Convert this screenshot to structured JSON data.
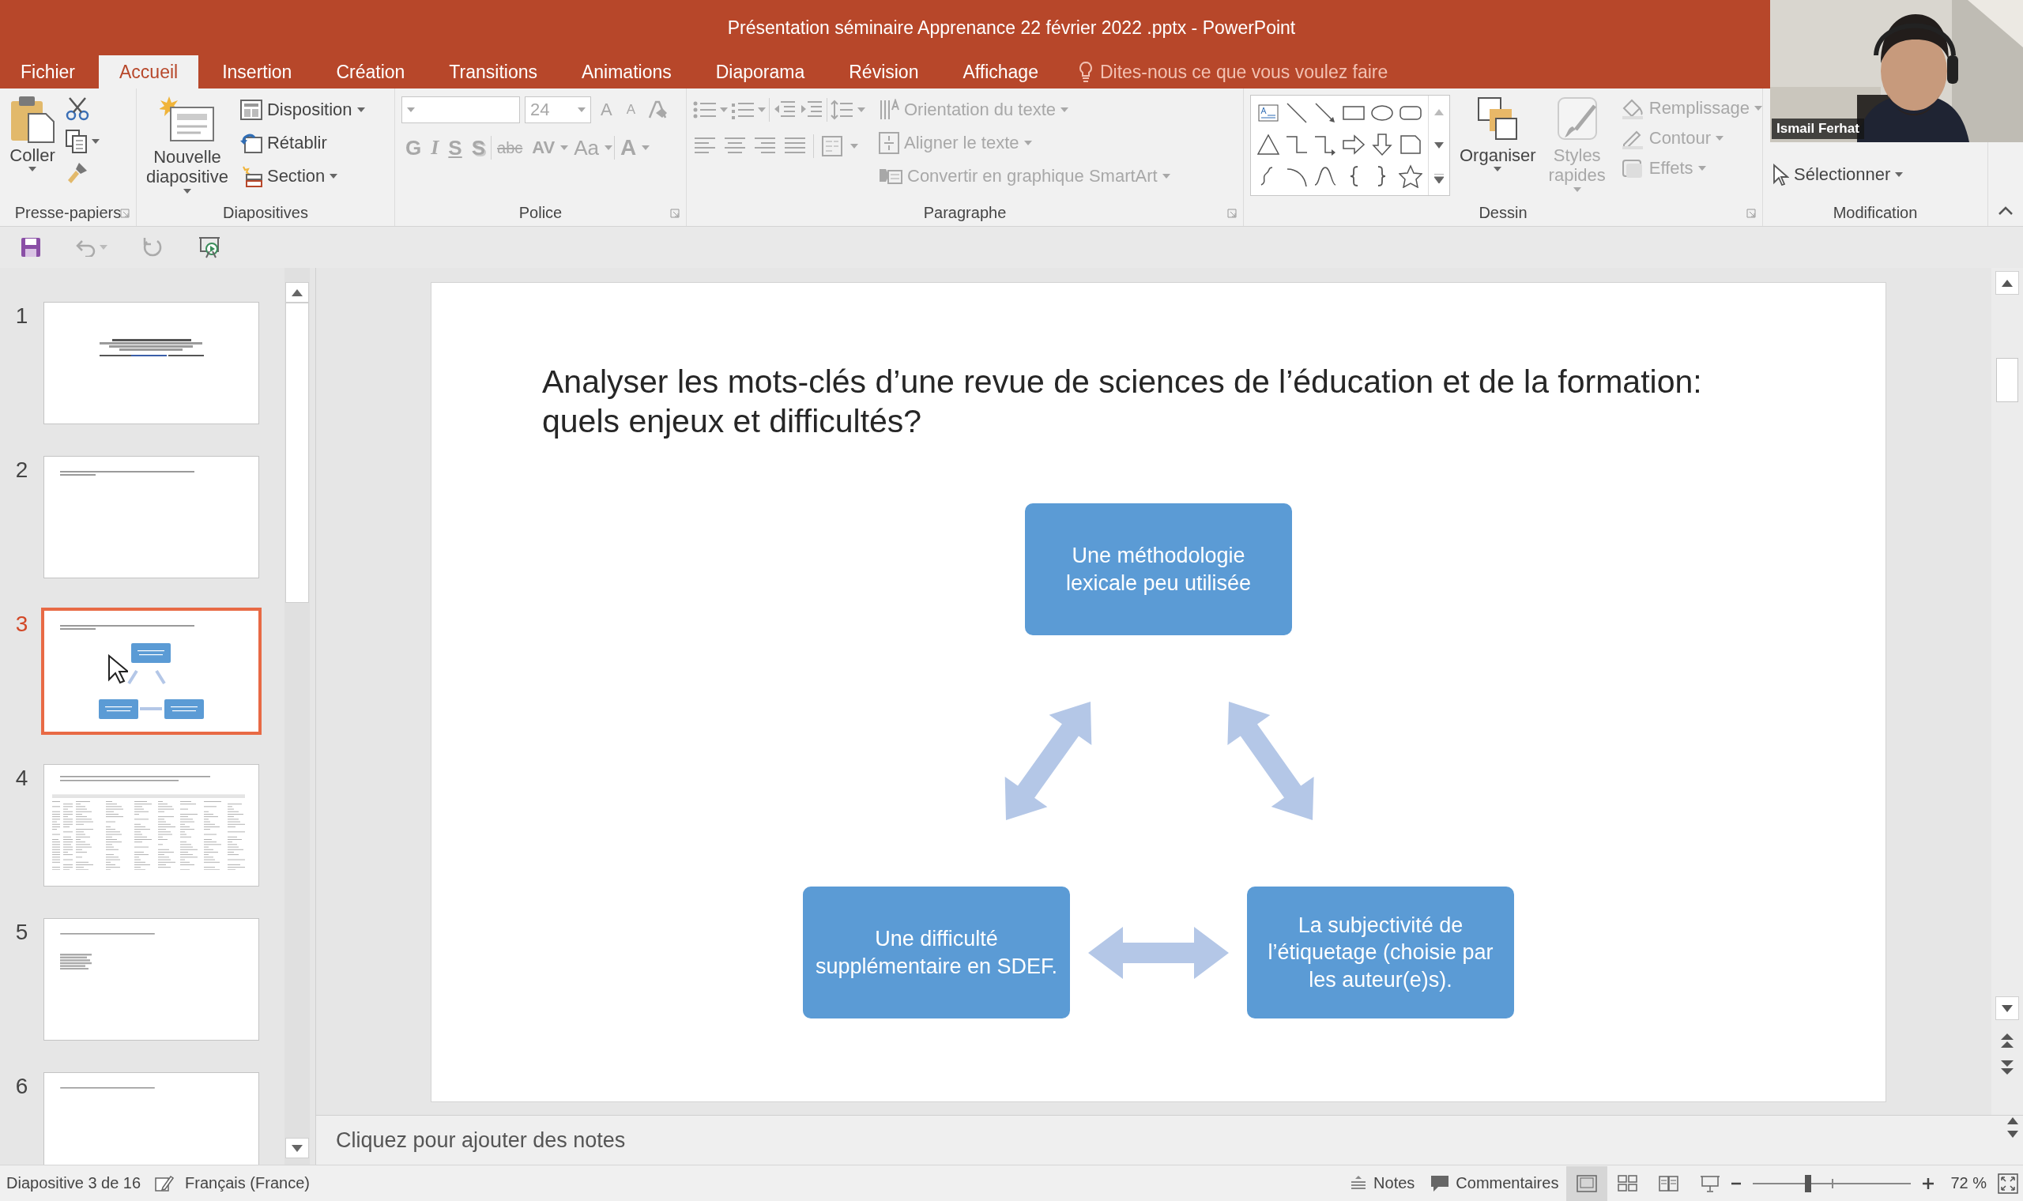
{
  "window": {
    "title": "Présentation séminaire Apprenance 22 février 2022 .pptx - PowerPoint"
  },
  "menu_tabs": [
    {
      "label": "Fichier",
      "selected": false
    },
    {
      "label": "Accueil",
      "selected": true
    },
    {
      "label": "Insertion",
      "selected": false
    },
    {
      "label": "Création",
      "selected": false
    },
    {
      "label": "Transitions",
      "selected": false
    },
    {
      "label": "Animations",
      "selected": false
    },
    {
      "label": "Diaporama",
      "selected": false
    },
    {
      "label": "Révision",
      "selected": false
    },
    {
      "label": "Affichage",
      "selected": false
    }
  ],
  "tell_me": {
    "placeholder": "Dites-nous ce que vous voulez faire"
  },
  "ribbon": {
    "clipboard": {
      "label": "Presse-papiers",
      "paste": "Coller"
    },
    "slides": {
      "label": "Diapositives",
      "new_slide": "Nouvelle\ndiapositive",
      "layout": "Disposition",
      "reset": "Rétablir",
      "section": "Section"
    },
    "font": {
      "label": "Police",
      "disabled": true,
      "font_size": "24",
      "size_buttons": [
        "A",
        "A"
      ],
      "format_buttons": [
        "G",
        "I",
        "S",
        "S",
        "abc",
        "AV",
        "Aa",
        "A"
      ]
    },
    "paragraph": {
      "label": "Paragraphe",
      "disabled": true,
      "text_direction": "Orientation du texte",
      "align_text": "Aligner le texte",
      "smartart": "Convertir en graphique SmartArt"
    },
    "drawing": {
      "label": "Dessin",
      "arrange": "Organiser",
      "quick_styles": "Styles\nrapides",
      "fill": "Remplissage",
      "outline": "Contour",
      "effects": "Effets",
      "styles_disabled": true
    },
    "editing": {
      "label": "Modification",
      "select": "Sélectionner"
    }
  },
  "slides": [
    {
      "number": "1",
      "selected": false,
      "kind": "title"
    },
    {
      "number": "2",
      "selected": false,
      "kind": "heading"
    },
    {
      "number": "3",
      "selected": true,
      "kind": "diagram"
    },
    {
      "number": "4",
      "selected": false,
      "kind": "table"
    },
    {
      "number": "5",
      "selected": false,
      "kind": "list"
    },
    {
      "number": "6",
      "selected": false,
      "kind": "line"
    }
  ],
  "current_slide": {
    "title": "Analyser les mots-clés d’une revue de sciences de l’éducation et de la formation:\nquels enjeux et difficultés?",
    "boxes": [
      "Une méthodologie\nlexicale peu utilisée",
      "Une difficulté\nsupplémentaire en SDEF.",
      "La subjectivité de\nl’étiquetage (choisie par\nles auteur(e)s)."
    ]
  },
  "notes": {
    "placeholder": "Cliquez pour ajouter des notes"
  },
  "status_bar": {
    "slide_info": "Diapositive 3 de 16",
    "language": "Français (France)",
    "notes": "Notes",
    "comments": "Commentaires",
    "views": [
      {
        "kind": "normal",
        "selected": true
      },
      {
        "kind": "sorter",
        "selected": false
      },
      {
        "kind": "reading",
        "selected": false
      },
      {
        "kind": "slideshow",
        "selected": false
      }
    ],
    "zoom": {
      "level": 0.35,
      "reading": "72 %"
    }
  },
  "webcam": {
    "name": "Ismail Ferhat"
  }
}
